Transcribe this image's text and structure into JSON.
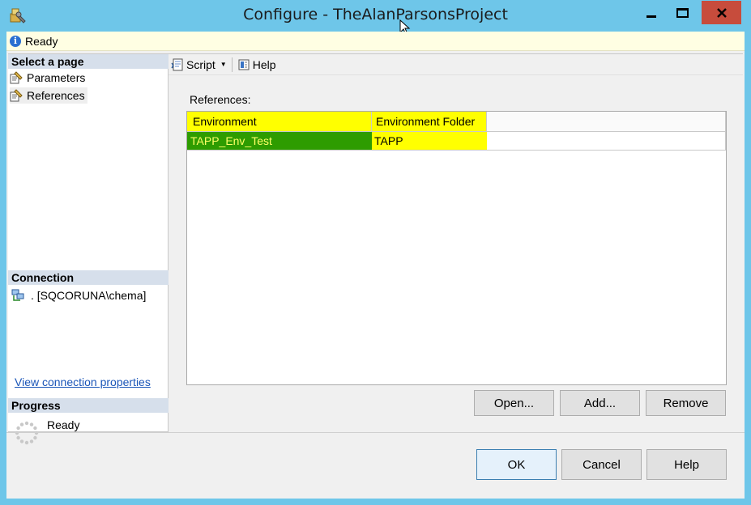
{
  "window": {
    "title": "Configure - TheAlanParsonsProject",
    "icon": "configure-app-icon",
    "controls": [
      "minimize",
      "maximize",
      "close"
    ]
  },
  "status": {
    "icon": "info-icon",
    "text": "Ready"
  },
  "left_pane": {
    "select_page_header": "Select a page",
    "pages": [
      {
        "label": "Parameters",
        "icon": "property-page-icon",
        "selected": false
      },
      {
        "label": "References",
        "icon": "property-page-icon",
        "selected": true
      }
    ],
    "connection_header": "Connection",
    "connection_text": ". [SQCORUNA\\chema]",
    "connection_link": "View connection properties",
    "progress_header": "Progress",
    "progress_text": "Ready"
  },
  "toolbar": {
    "script_label": "Script",
    "help_label": "Help"
  },
  "references": {
    "label": "References:",
    "columns": [
      "Environment",
      "Environment Folder",
      ""
    ],
    "rows": [
      {
        "environment": "TAPP_Env_Test",
        "folder": "TAPP"
      }
    ],
    "buttons": {
      "open": "Open...",
      "add": "Add...",
      "remove": "Remove"
    }
  },
  "dialog_buttons": {
    "ok": "OK",
    "cancel": "Cancel",
    "help": "Help"
  },
  "colors": {
    "titlebar": "#6ec6e9",
    "close_button": "#c74c3c",
    "highlight_yellow": "#ffff00",
    "selected_row_green": "#2e9c00",
    "link_blue": "#1a55b8"
  }
}
